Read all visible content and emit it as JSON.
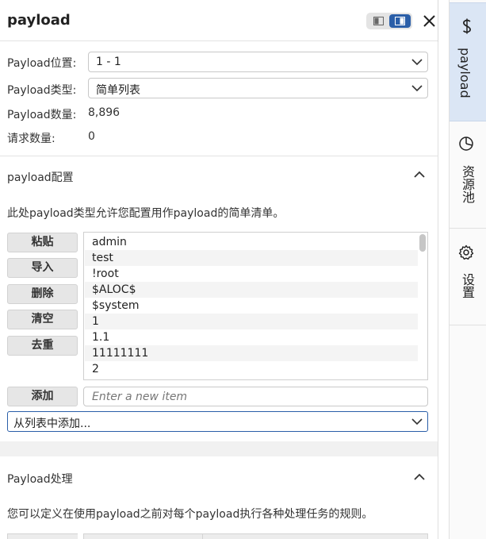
{
  "header": {
    "title": "payload"
  },
  "fields": {
    "position_label": "Payload位置:",
    "position_value": "1 - 1",
    "type_label": "Payload类型:",
    "type_value": "简单列表",
    "count_label": "Payload数量:",
    "count_value": "8,896",
    "request_label": "请求数量:",
    "request_value": "0"
  },
  "payload_config": {
    "title": "payload配置",
    "description": "此处payload类型允许您配置用作payload的简单清单。",
    "buttons": [
      "粘贴",
      "导入",
      "删除",
      "清空",
      "去重"
    ],
    "items": [
      "admin",
      "test",
      "!root",
      "$ALOC$",
      "$system",
      "1",
      "1.1",
      "11111111",
      "2"
    ],
    "add_label": "添加",
    "add_placeholder": "Enter a new item",
    "from_list_label": "从列表中添加..."
  },
  "processing": {
    "title": "Payload处理",
    "description": "您可以定义在使用payload之前对每个payload执行各种处理任务的规则。"
  },
  "sidebar": {
    "tabs": [
      {
        "label": "payload",
        "icon": "dollar-icon",
        "active": true
      },
      {
        "label": "资源池",
        "icon": "pie-chart-icon",
        "active": false
      },
      {
        "label": "设置",
        "icon": "gear-icon",
        "active": false
      }
    ]
  },
  "colors": {
    "accent": "#2a5ea8",
    "active_tab_bg": "#dbe6f5"
  }
}
